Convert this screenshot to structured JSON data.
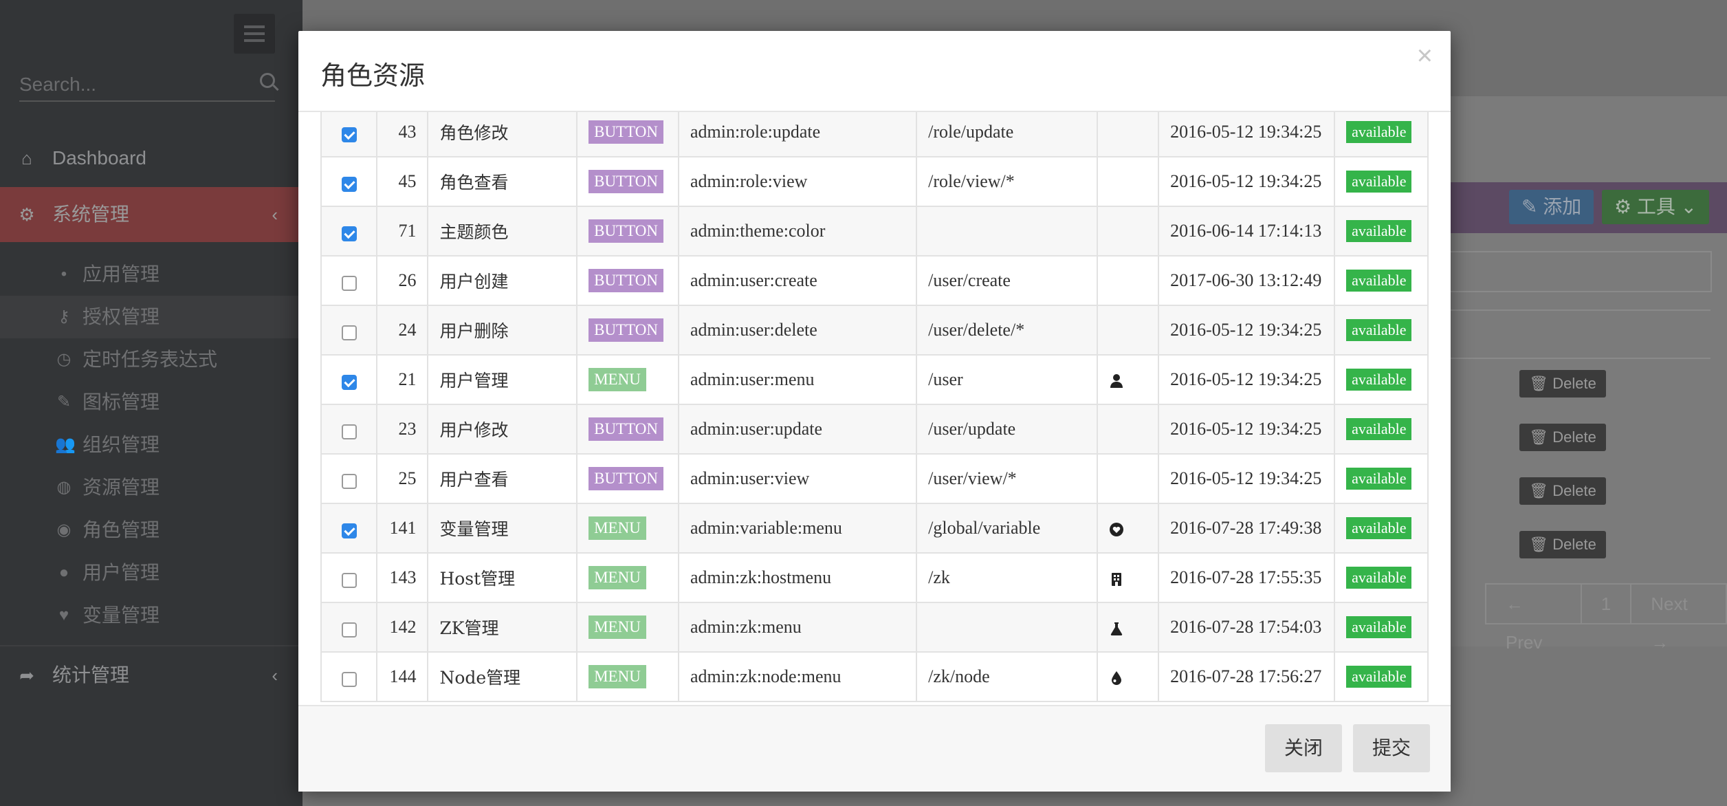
{
  "sidebar": {
    "search_placeholder": "Search...",
    "dashboard": "Dashboard",
    "system": "系统管理",
    "stats": "统计管理",
    "items": [
      {
        "label": "应用管理",
        "icon": "apple-icon"
      },
      {
        "label": "授权管理",
        "icon": "key-icon"
      },
      {
        "label": "定时任务表达式",
        "icon": "clock-icon"
      },
      {
        "label": "图标管理",
        "icon": "pen-icon"
      },
      {
        "label": "组织管理",
        "icon": "users-icon"
      },
      {
        "label": "资源管理",
        "icon": "globe-icon"
      },
      {
        "label": "角色管理",
        "icon": "eye-icon"
      },
      {
        "label": "用户管理",
        "icon": "user-icon"
      },
      {
        "label": "变量管理",
        "icon": "heart-icon"
      }
    ]
  },
  "content": {
    "add_label": "添加",
    "tools_label": "工具",
    "delete_label": "Delete",
    "pager": {
      "prev": "← Prev",
      "page": "1",
      "next": "Next →"
    }
  },
  "modal": {
    "title": "角色资源",
    "close_label": "关闭",
    "submit_label": "提交",
    "rows": [
      {
        "checked": true,
        "id": "43",
        "name": "角色修改",
        "type": "BUTTON",
        "permission": "admin:role:update",
        "url": "/role/update",
        "icon": "",
        "time": "2016-05-12 19:34:25",
        "status": "available"
      },
      {
        "checked": true,
        "id": "45",
        "name": "角色查看",
        "type": "BUTTON",
        "permission": "admin:role:view",
        "url": "/role/view/*",
        "icon": "",
        "time": "2016-05-12 19:34:25",
        "status": "available"
      },
      {
        "checked": true,
        "id": "71",
        "name": "主题颜色",
        "type": "BUTTON",
        "permission": "admin:theme:color",
        "url": "",
        "icon": "",
        "time": "2016-06-14 17:14:13",
        "status": "available"
      },
      {
        "checked": false,
        "id": "26",
        "name": "用户创建",
        "type": "BUTTON",
        "permission": "admin:user:create",
        "url": "/user/create",
        "icon": "",
        "time": "2017-06-30 13:12:49",
        "status": "available"
      },
      {
        "checked": false,
        "id": "24",
        "name": "用户删除",
        "type": "BUTTON",
        "permission": "admin:user:delete",
        "url": "/user/delete/*",
        "icon": "",
        "time": "2016-05-12 19:34:25",
        "status": "available"
      },
      {
        "checked": true,
        "id": "21",
        "name": "用户管理",
        "type": "MENU",
        "permission": "admin:user:menu",
        "url": "/user",
        "icon": "user-icon",
        "time": "2016-05-12 19:34:25",
        "status": "available"
      },
      {
        "checked": false,
        "id": "23",
        "name": "用户修改",
        "type": "BUTTON",
        "permission": "admin:user:update",
        "url": "/user/update",
        "icon": "",
        "time": "2016-05-12 19:34:25",
        "status": "available"
      },
      {
        "checked": false,
        "id": "25",
        "name": "用户查看",
        "type": "BUTTON",
        "permission": "admin:user:view",
        "url": "/user/view/*",
        "icon": "",
        "time": "2016-05-12 19:34:25",
        "status": "available"
      },
      {
        "checked": true,
        "id": "141",
        "name": "变量管理",
        "type": "MENU",
        "permission": "admin:variable:menu",
        "url": "/global/variable",
        "icon": "heart-icon",
        "time": "2016-07-28 17:49:38",
        "status": "available"
      },
      {
        "checked": false,
        "id": "143",
        "name": "Host管理",
        "type": "MENU",
        "permission": "admin:zk:hostmenu",
        "url": "/zk",
        "icon": "building-icon",
        "time": "2016-07-28 17:55:35",
        "status": "available"
      },
      {
        "checked": false,
        "id": "142",
        "name": "ZK管理",
        "type": "MENU",
        "permission": "admin:zk:menu",
        "url": "",
        "icon": "flask-icon",
        "time": "2016-07-28 17:54:03",
        "status": "available"
      },
      {
        "checked": false,
        "id": "144",
        "name": "Node管理",
        "type": "MENU",
        "permission": "admin:zk:node:menu",
        "url": "/zk/node",
        "icon": "drop-icon",
        "time": "2016-07-28 17:56:27",
        "status": "available"
      }
    ]
  }
}
